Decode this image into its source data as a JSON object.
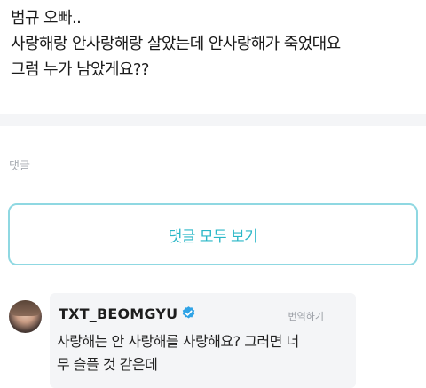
{
  "post": {
    "lines": [
      "범규 오빠..",
      "사랑해랑 안사랑해랑 살았는데 안사랑해가 죽었대요",
      "그럼 누가 남았게요??"
    ]
  },
  "comments": {
    "label": "댓글",
    "view_all_label": "댓글 모두 보기"
  },
  "reply": {
    "author": "TXT_BEOMGYU",
    "translate_label": "번역하기",
    "lines": [
      "사랑해는 안 사랑해를 사랑해요? 그러면 너",
      "무 슬플 것 같은데"
    ]
  },
  "colors": {
    "accent": "#2bb7c7",
    "verified": "#2fa3e6"
  },
  "icons": {
    "verified": "verified-badge-icon"
  }
}
